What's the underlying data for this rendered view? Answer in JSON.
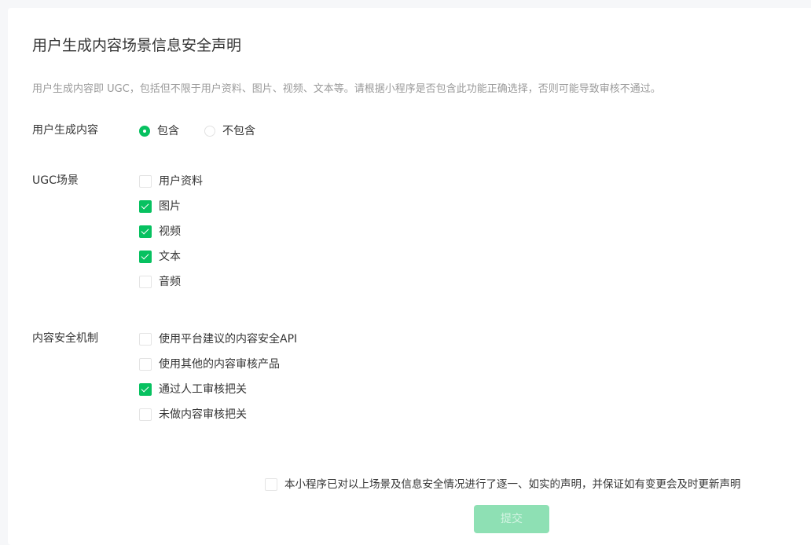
{
  "page": {
    "title": "用户生成内容场景信息安全声明",
    "description": "用户生成内容即 UGC，包括但不限于用户资料、图片、视频、文本等。请根据小程序是否包含此功能正确选择，否则可能导致审核不通过。"
  },
  "ugc_content": {
    "label": "用户生成内容",
    "options": [
      {
        "label": "包含",
        "selected": true
      },
      {
        "label": "不包含",
        "selected": false
      }
    ]
  },
  "ugc_scene": {
    "label": "UGC场景",
    "options": [
      {
        "label": "用户资料",
        "checked": false
      },
      {
        "label": "图片",
        "checked": true
      },
      {
        "label": "视频",
        "checked": true
      },
      {
        "label": "文本",
        "checked": true
      },
      {
        "label": "音频",
        "checked": false
      }
    ]
  },
  "content_security": {
    "label": "内容安全机制",
    "options": [
      {
        "label": "使用平台建议的内容安全API",
        "checked": false
      },
      {
        "label": "使用其他的内容审核产品",
        "checked": false
      },
      {
        "label": "通过人工审核把关",
        "checked": true
      },
      {
        "label": "未做内容审核把关",
        "checked": false
      }
    ]
  },
  "declaration": {
    "label": "本小程序已对以上场景及信息安全情况进行了逐一、如实的声明，并保证如有变更会及时更新声明",
    "checked": false
  },
  "submit": {
    "label": "提交",
    "enabled": false
  },
  "colors": {
    "accent": "#07c160",
    "disabled_button": "#8ee0b4"
  }
}
